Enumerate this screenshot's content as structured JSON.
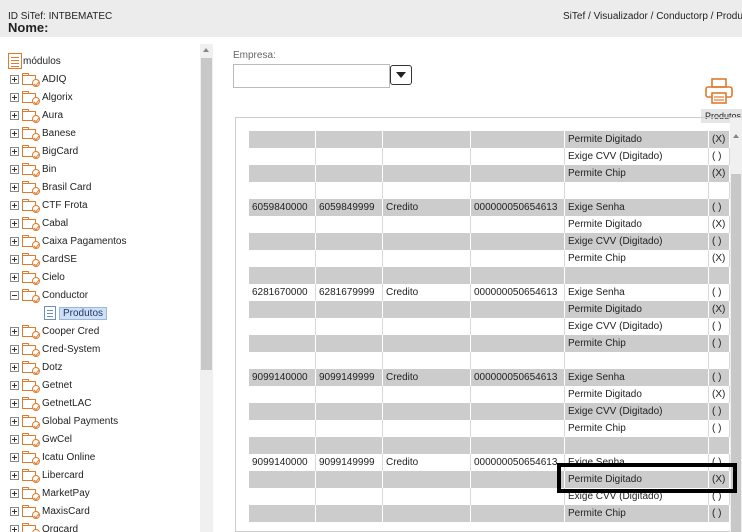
{
  "header": {
    "id_line": "ID SiTef: INTBEMATEC",
    "name_line": "Nome:",
    "breadcrumb": "SiTef / Visualizador / Conductorp / Produ"
  },
  "tree": {
    "root_label": "módulos",
    "items": [
      {
        "label": "ADIQ",
        "expanded": false
      },
      {
        "label": "Algorix",
        "expanded": false
      },
      {
        "label": "Aura",
        "expanded": false
      },
      {
        "label": "Banese",
        "expanded": false
      },
      {
        "label": "BigCard",
        "expanded": false
      },
      {
        "label": "Bin",
        "expanded": false
      },
      {
        "label": "Brasil Card",
        "expanded": false
      },
      {
        "label": "CTF Frota",
        "expanded": false
      },
      {
        "label": "Cabal",
        "expanded": false
      },
      {
        "label": "Caixa Pagamentos",
        "expanded": false
      },
      {
        "label": "CardSE",
        "expanded": false
      },
      {
        "label": "Cielo",
        "expanded": false
      },
      {
        "label": "Conductor",
        "expanded": true
      },
      {
        "label": "Produtos",
        "child": true,
        "selected": true
      },
      {
        "label": "Cooper Cred",
        "expanded": false
      },
      {
        "label": "Cred-System",
        "expanded": false
      },
      {
        "label": "Dotz",
        "expanded": false
      },
      {
        "label": "Getnet",
        "expanded": false
      },
      {
        "label": "GetnetLAC",
        "expanded": false
      },
      {
        "label": "Global Payments",
        "expanded": false
      },
      {
        "label": "GwCel",
        "expanded": false
      },
      {
        "label": "Icatu Online",
        "expanded": false
      },
      {
        "label": "Libercard",
        "expanded": false
      },
      {
        "label": "MarketPay",
        "expanded": false
      },
      {
        "label": "MaxisCard",
        "expanded": false
      },
      {
        "label": "Orgcard",
        "expanded": false
      }
    ]
  },
  "empresa": {
    "label": "Empresa:",
    "value": ""
  },
  "print": {
    "tooltip": "Produtos"
  },
  "table": {
    "rows": [
      [
        "",
        "",
        "",
        "",
        "Permite Digitado",
        "(X)"
      ],
      [
        "",
        "",
        "",
        "",
        "Exige CVV (Digitado)",
        "( )"
      ],
      [
        "",
        "",
        "",
        "",
        "Permite Chip",
        "(X)"
      ],
      [
        "",
        "",
        "",
        "",
        "",
        ""
      ],
      [
        "6059840000",
        "6059849999",
        "Credito",
        "000000050654613",
        "Exige Senha",
        "( )"
      ],
      [
        "",
        "",
        "",
        "",
        "Permite Digitado",
        "(X)"
      ],
      [
        "",
        "",
        "",
        "",
        "Exige CVV (Digitado)",
        "( )"
      ],
      [
        "",
        "",
        "",
        "",
        "Permite Chip",
        "(X)"
      ],
      [
        "",
        "",
        "",
        "",
        "",
        ""
      ],
      [
        "6281670000",
        "6281679999",
        "Credito",
        "000000050654613",
        "Exige Senha",
        "( )"
      ],
      [
        "",
        "",
        "",
        "",
        "Permite Digitado",
        "(X)"
      ],
      [
        "",
        "",
        "",
        "",
        "Exige CVV (Digitado)",
        "( )"
      ],
      [
        "",
        "",
        "",
        "",
        "Permite Chip",
        "( )"
      ],
      [
        "",
        "",
        "",
        "",
        "",
        ""
      ],
      [
        "9099140000",
        "9099149999",
        "Credito",
        "000000050654613",
        "Exige Senha",
        "( )"
      ],
      [
        "",
        "",
        "",
        "",
        "Permite Digitado",
        "(X)"
      ],
      [
        "",
        "",
        "",
        "",
        "Exige CVV (Digitado)",
        "( )"
      ],
      [
        "",
        "",
        "",
        "",
        "Permite Chip",
        "( )"
      ],
      [
        "",
        "",
        "",
        "",
        "",
        ""
      ],
      [
        "9099140000",
        "9099149999",
        "Credito",
        "000000050654613",
        "Exige Senha",
        "( )"
      ],
      [
        "",
        "",
        "",
        "",
        "Permite Digitado",
        "(X)"
      ],
      [
        "",
        "",
        "",
        "",
        "Exige CVV (Digitado)",
        "( )"
      ],
      [
        "",
        "",
        "",
        "",
        "Permite Chip",
        "( )"
      ]
    ]
  },
  "colors": {
    "accent": "#e07a2d",
    "row_gray": "#cccccc",
    "highlight_box": "#000000"
  }
}
